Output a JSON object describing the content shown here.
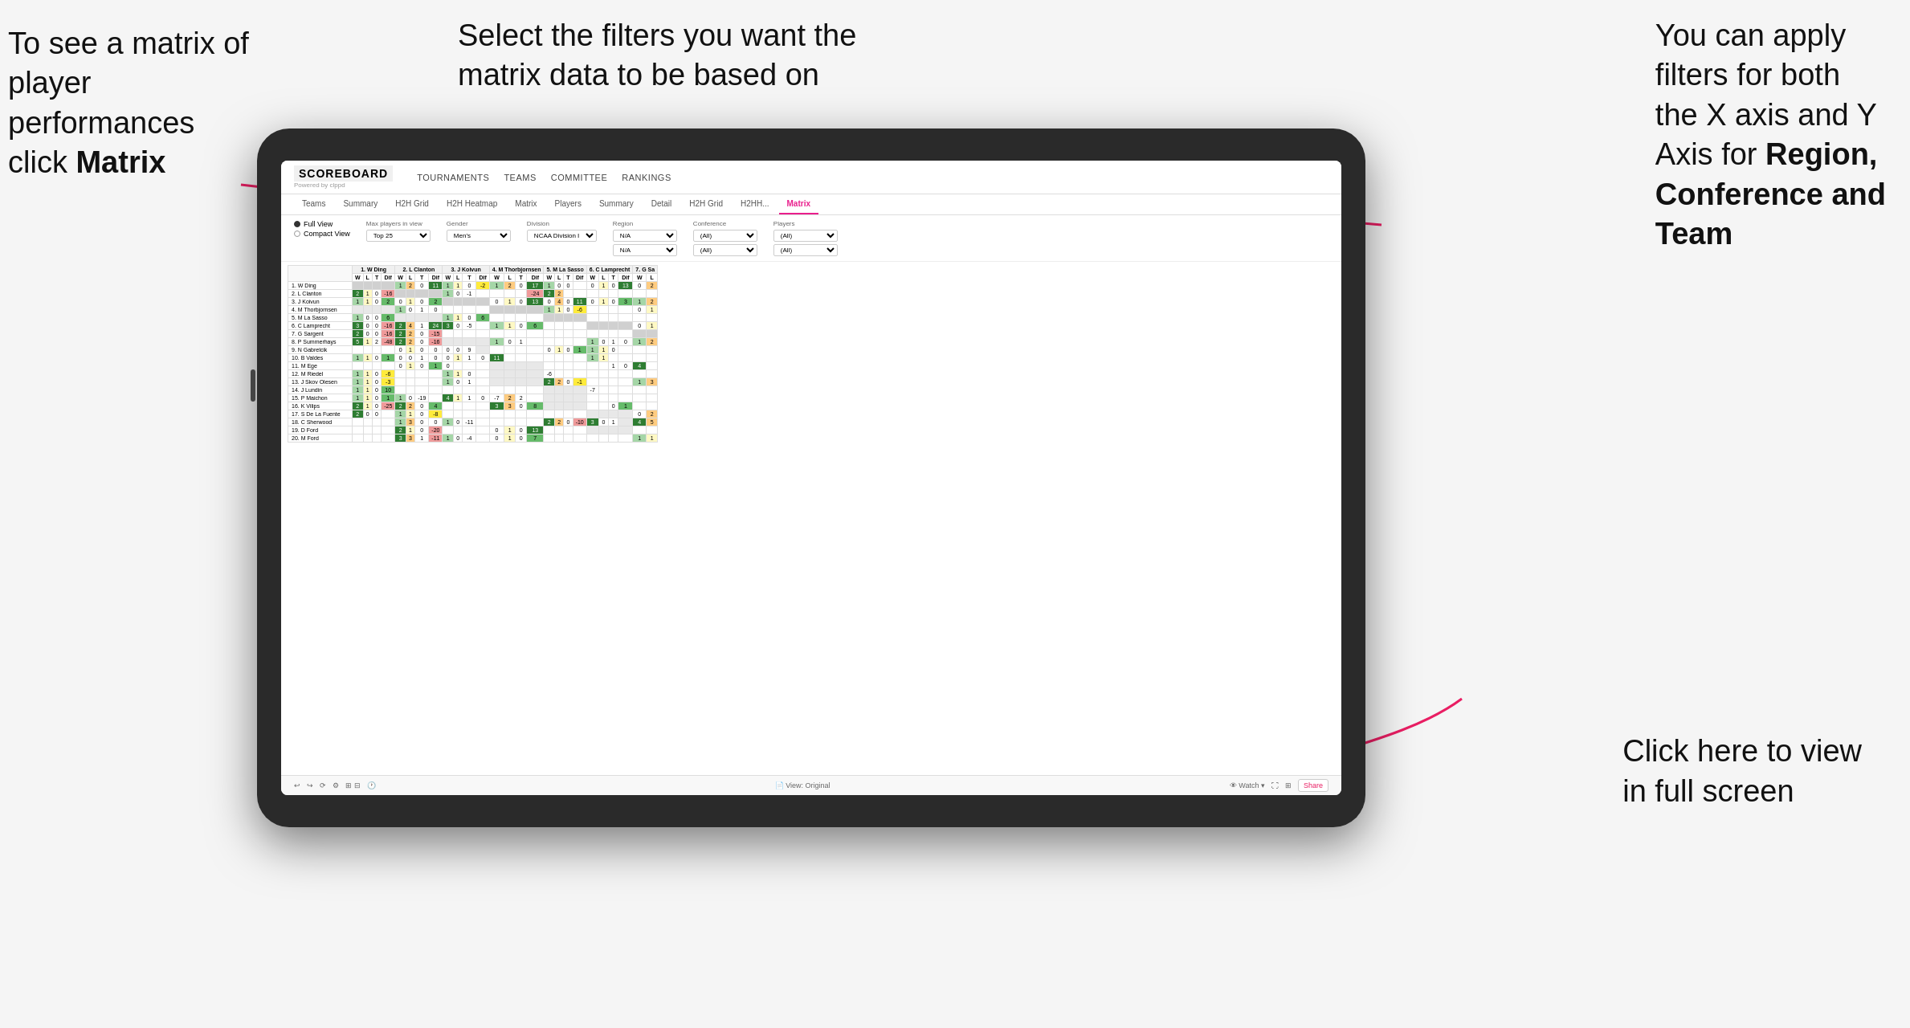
{
  "annotations": {
    "top_left": {
      "line1": "To see a matrix of",
      "line2": "player performances",
      "line3_prefix": "click ",
      "line3_bold": "Matrix"
    },
    "top_center": {
      "line1": "Select the filters you want the",
      "line2": "matrix data to be based on"
    },
    "top_right": {
      "line1": "You  can apply",
      "line2": "filters for both",
      "line3": "the X axis and Y",
      "line4_prefix": "Axis for ",
      "line4_bold": "Region,",
      "line5_bold": "Conference and",
      "line6_bold": "Team"
    },
    "bottom_right": {
      "line1": "Click here to view",
      "line2": "in full screen"
    }
  },
  "nav": {
    "logo_main": "SCOREBOARD",
    "logo_sub": "Powered by clppd",
    "links": [
      "TOURNAMENTS",
      "TEAMS",
      "COMMITTEE",
      "RANKINGS"
    ]
  },
  "tabs": {
    "items": [
      "Teams",
      "Summary",
      "H2H Grid",
      "H2H Heatmap",
      "Matrix",
      "Players",
      "Summary",
      "Detail",
      "H2H Grid",
      "H2HH...",
      "Matrix"
    ],
    "active_index": 10
  },
  "filters": {
    "view_options": [
      "Full View",
      "Compact View"
    ],
    "selected_view": "Full View",
    "max_players_label": "Max players in view",
    "max_players_value": "Top 25",
    "gender_label": "Gender",
    "gender_value": "Men's",
    "division_label": "Division",
    "division_value": "NCAA Division I",
    "region_label": "Region",
    "region_values": [
      "N/A",
      "N/A"
    ],
    "conference_label": "Conference",
    "conference_values": [
      "(All)",
      "(All)"
    ],
    "players_label": "Players",
    "players_values": [
      "(All)",
      "(All)"
    ]
  },
  "matrix": {
    "col_headers": [
      "1. W Ding",
      "2. L Clanton",
      "3. J Koivun",
      "4. M Thorbjornsen",
      "5. M La Sasso",
      "6. C Lamprecht",
      "7. G Sa"
    ],
    "col_sub": [
      "W",
      "L",
      "T",
      "Dif"
    ],
    "rows": [
      {
        "name": "1. W Ding",
        "cells": [
          "",
          "",
          "",
          "",
          "1",
          "2",
          "0",
          "11",
          "1",
          "1",
          "0",
          "-2",
          "1",
          "2",
          "0",
          "17",
          "1",
          "0",
          "0",
          "",
          "0",
          "1",
          "0",
          "13",
          "0",
          "2"
        ]
      },
      {
        "name": "2. L Clanton",
        "cells": [
          "2",
          "1",
          "0",
          "-16",
          "",
          "",
          "",
          "",
          "1",
          "0",
          "-1",
          "",
          "",
          "",
          "",
          "-24",
          "2",
          "2",
          ""
        ]
      },
      {
        "name": "3. J Koivun",
        "cells": [
          "1",
          "1",
          "0",
          "2",
          "0",
          "1",
          "0",
          "2",
          "",
          "",
          "",
          "",
          "0",
          "1",
          "0",
          "13",
          "0",
          "4",
          "0",
          "11",
          "0",
          "1",
          "0",
          "3",
          "1",
          "2"
        ]
      },
      {
        "name": "4. M Thorbjornsen",
        "cells": [
          "",
          "",
          "",
          "",
          "1",
          "0",
          "1",
          "0",
          "",
          "",
          "",
          "",
          "0",
          "0",
          "1",
          "0",
          "1",
          "1",
          "0",
          "-6",
          "",
          "",
          "",
          "",
          "0",
          "1"
        ]
      },
      {
        "name": "5. M La Sasso",
        "cells": [
          "1",
          "0",
          "0",
          "6",
          "",
          "",
          "",
          "",
          "1",
          "1",
          "0",
          "6",
          "",
          "",
          "",
          "",
          "",
          "",
          "",
          "",
          "",
          "",
          "",
          "",
          "",
          ""
        ]
      },
      {
        "name": "6. C Lamprecht",
        "cells": [
          "3",
          "0",
          "0",
          "-16",
          "2",
          "4",
          "1",
          "24",
          "3",
          "0",
          "-5",
          "",
          "1",
          "1",
          "0",
          "6",
          "",
          "",
          "",
          "",
          "",
          "",
          "",
          "",
          "0",
          "1"
        ]
      },
      {
        "name": "7. G Sargent",
        "cells": [
          "2",
          "0",
          "0",
          "-16",
          "2",
          "2",
          "0",
          "-15",
          "",
          "",
          "",
          "",
          "",
          "",
          "",
          "",
          "",
          "",
          "",
          "",
          "",
          "",
          "",
          "",
          "",
          ""
        ]
      },
      {
        "name": "8. P Summerhays",
        "cells": [
          "5",
          "1",
          "2",
          "-48",
          "2",
          "2",
          "0",
          "-16",
          "",
          "",
          "",
          "",
          "1",
          "0",
          "1",
          "",
          "",
          "",
          "",
          "",
          "1",
          "0",
          "1",
          "0",
          "1",
          "2"
        ]
      },
      {
        "name": "9. N Gabrelcik",
        "cells": [
          "",
          "",
          "",
          "",
          "0",
          "1",
          "0",
          "0",
          "0",
          "0",
          "9",
          "",
          "",
          "",
          "",
          "",
          "0",
          "1",
          "0",
          "1",
          "1",
          "1",
          "0",
          ""
        ]
      },
      {
        "name": "10. B Valdes",
        "cells": [
          "1",
          "1",
          "0",
          "1",
          "0",
          "0",
          "1",
          "0",
          "0",
          "1",
          "1",
          "0",
          "11",
          "",
          "",
          "",
          "",
          "",
          "",
          "",
          "1",
          "1"
        ]
      },
      {
        "name": "11. M Ege",
        "cells": [
          "",
          "",
          "",
          "",
          "0",
          "1",
          "0",
          "1",
          "0",
          "",
          "",
          "",
          "",
          "",
          "",
          "",
          "",
          "",
          "",
          "",
          "",
          "",
          "1",
          "0",
          "4"
        ]
      },
      {
        "name": "12. M Riedel",
        "cells": [
          "1",
          "1",
          "0",
          "-6",
          "",
          "",
          "",
          "",
          "1",
          "1",
          "0",
          "",
          "",
          "",
          "",
          "",
          "-6",
          "",
          "",
          "",
          "",
          "",
          "",
          "",
          "",
          ""
        ]
      },
      {
        "name": "13. J Skov Olesen",
        "cells": [
          "1",
          "1",
          "0",
          "-3",
          "",
          "",
          "",
          "",
          "1",
          "0",
          "1",
          "",
          "",
          "",
          "",
          "",
          "2",
          "2",
          "0",
          "-1",
          "",
          "",
          "",
          "",
          "1",
          "3"
        ]
      },
      {
        "name": "14. J Lundin",
        "cells": [
          "1",
          "1",
          "0",
          "10",
          "",
          "",
          "",
          "",
          "",
          "",
          "",
          "",
          "",
          "",
          "",
          "",
          "",
          "",
          "",
          "",
          "-7",
          "",
          "",
          "",
          "",
          ""
        ]
      },
      {
        "name": "15. P Maichon",
        "cells": [
          "1",
          "1",
          "0",
          "1",
          "1",
          "0",
          "-19",
          "",
          "4",
          "1",
          "1",
          "0",
          "-7",
          "2",
          "2"
        ]
      },
      {
        "name": "16. K Vilips",
        "cells": [
          "2",
          "1",
          "0",
          "-25",
          "2",
          "2",
          "0",
          "4",
          "",
          "",
          "",
          "",
          "3",
          "3",
          "0",
          "8",
          "",
          "",
          "",
          "",
          "",
          "",
          "0",
          "1"
        ]
      },
      {
        "name": "17. S De La Fuente",
        "cells": [
          "2",
          "0",
          "0",
          "",
          "1",
          "1",
          "0",
          "-8",
          "",
          "",
          "",
          "",
          "",
          "",
          "",
          "",
          "",
          "",
          "",
          "",
          "",
          "",
          "",
          "",
          "0",
          "2"
        ]
      },
      {
        "name": "18. C Sherwood",
        "cells": [
          "",
          "",
          "",
          "",
          "1",
          "3",
          "0",
          "0",
          "1",
          "0",
          "-11",
          "",
          "",
          "",
          "",
          "",
          "2",
          "2",
          "0",
          "-10",
          "3",
          "0",
          "1",
          "",
          "4",
          "5"
        ]
      },
      {
        "name": "19. D Ford",
        "cells": [
          "",
          "",
          "",
          "",
          "2",
          "1",
          "0",
          "-20",
          "",
          "",
          "",
          "",
          "0",
          "1",
          "0",
          "13",
          "",
          "",
          "",
          "",
          "",
          "",
          "",
          "",
          "",
          ""
        ]
      },
      {
        "name": "20. M Ford",
        "cells": [
          "",
          "",
          "",
          "",
          "3",
          "3",
          "1",
          "-11",
          "1",
          "0",
          "-4",
          "",
          "0",
          "1",
          "0",
          "7",
          "",
          "",
          "",
          "",
          "",
          "",
          "",
          "",
          "1",
          "1"
        ]
      }
    ]
  },
  "toolbar": {
    "view_label": "View: Original",
    "watch_label": "Watch",
    "share_label": "Share"
  }
}
